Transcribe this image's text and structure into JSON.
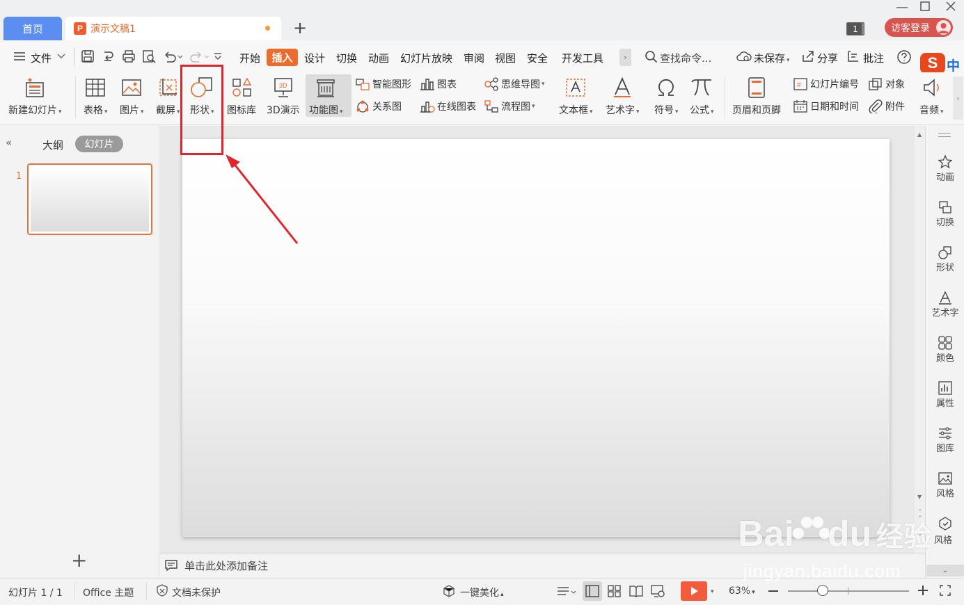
{
  "tabs": {
    "home": "首页",
    "doc_title": "演示文稿1",
    "add": "+"
  },
  "titlebar": {
    "window_count": "1",
    "login_label": "访客登录"
  },
  "menu": {
    "file": "文件",
    "items": [
      "开始",
      "插入",
      "设计",
      "切换",
      "动画",
      "幻灯片放映",
      "审阅",
      "视图",
      "安全",
      "开发工具"
    ],
    "active": "插入",
    "search_placeholder": "查找命令...",
    "unsaved": "未保存",
    "share": "分享",
    "comment": "批注"
  },
  "ribbon": {
    "new_slide": "新建幻灯片",
    "table": "表格",
    "picture": "图片",
    "screenshot": "截屏",
    "shape": "形状",
    "icon_lib": "图标库",
    "demo3d": "3D演示",
    "function_chart": "功能图",
    "smart_art": "智能图形",
    "chart": "图表",
    "mind_map": "思维导图",
    "relation": "关系图",
    "online_chart": "在线图表",
    "flow_chart": "流程图",
    "text_box": "文本框",
    "word_art": "艺术字",
    "symbol": "符号",
    "formula": "公式",
    "header_footer": "页眉和页脚",
    "slide_number": "幻灯片编号",
    "object": "对象",
    "date_time": "日期和时间",
    "attachment": "附件",
    "audio": "音频"
  },
  "left_panel": {
    "outline": "大纲",
    "slides": "幻灯片",
    "slide_number": "1",
    "add": "+"
  },
  "notes": {
    "placeholder": "单击此处添加备注"
  },
  "right_sidebar": [
    "动画",
    "切换",
    "形状",
    "艺术字",
    "颜色",
    "属性",
    "图库",
    "风格"
  ],
  "status": {
    "slide_count": "幻灯片 1 / 1",
    "theme": "Office 主题",
    "protection": "文档未保护",
    "beautify": "一键美化",
    "zoom": "63%",
    "zoom_level": 0.63
  },
  "ime": {
    "label": "中"
  },
  "watermark": {
    "brand": "Bai",
    "brand2": "du",
    "cn": "经验",
    "url": "jingyan.baidu.com"
  },
  "colors": {
    "accent": "#ec6c2e",
    "home_tab": "#5b8ef0",
    "annotation": "#e0262b",
    "login": "#d9534f"
  }
}
